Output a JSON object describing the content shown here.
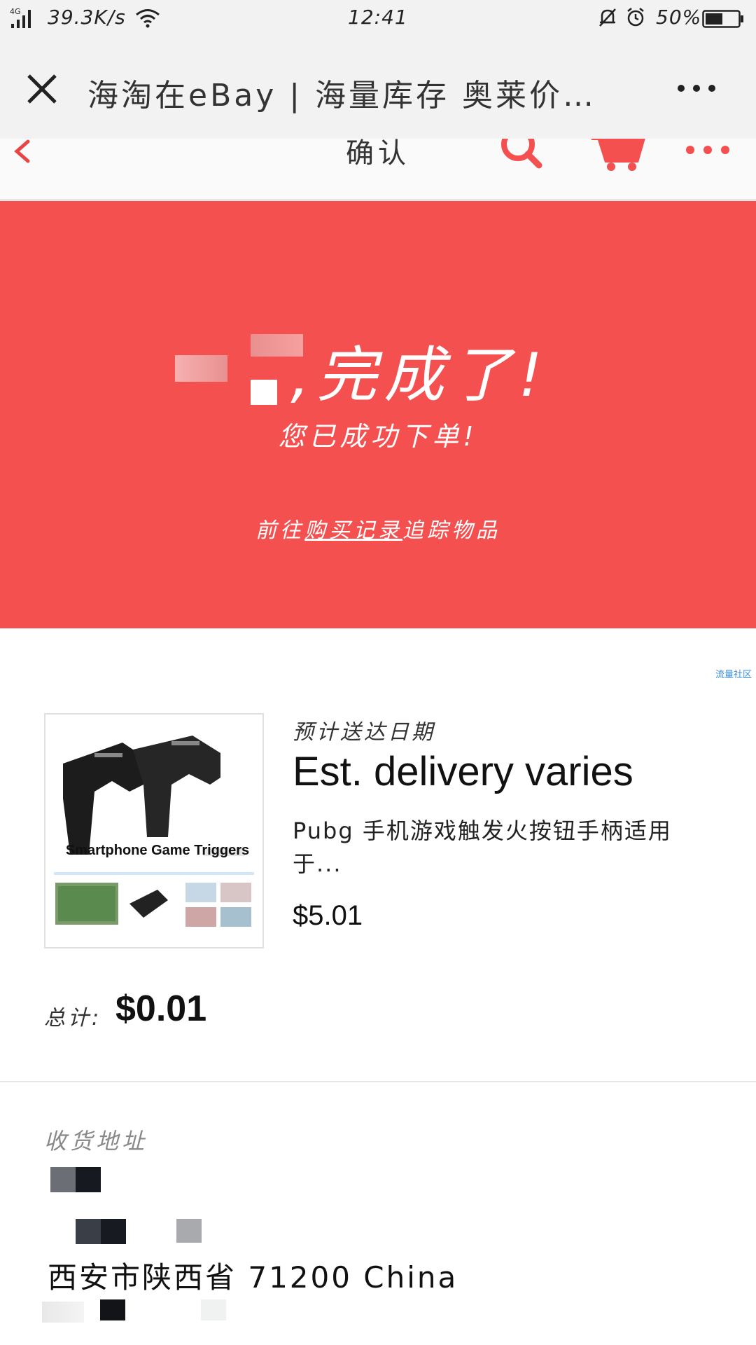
{
  "status_bar": {
    "network": "4G",
    "speed": "39.3K/s",
    "time": "12:41",
    "battery": "50%"
  },
  "title_bar": {
    "title": "海淘在eBay | 海量库存 奥莱价…"
  },
  "nav": {
    "title": "确认"
  },
  "hero": {
    "title": ",完成了!",
    "subtitle": "您已成功下单!",
    "link_prefix": "前往",
    "link_text": "购买记录",
    "link_suffix": "追踪物品"
  },
  "product": {
    "tag": "流量社区",
    "image_caption": "Smartphone Game Triggers",
    "delivery_label": "预计送达日期",
    "delivery_value": "Est. delivery varies",
    "title": "Pubg 手机游戏触发火按钮手柄适用于...",
    "price": "$5.01"
  },
  "total": {
    "label": "总计:",
    "value": "$0.01"
  },
  "address": {
    "label": "收货地址",
    "city_line": "西安市陕西省 71200 China"
  },
  "colors": {
    "accent_red": "#f55050",
    "header_gray": "#f2f2f2"
  }
}
